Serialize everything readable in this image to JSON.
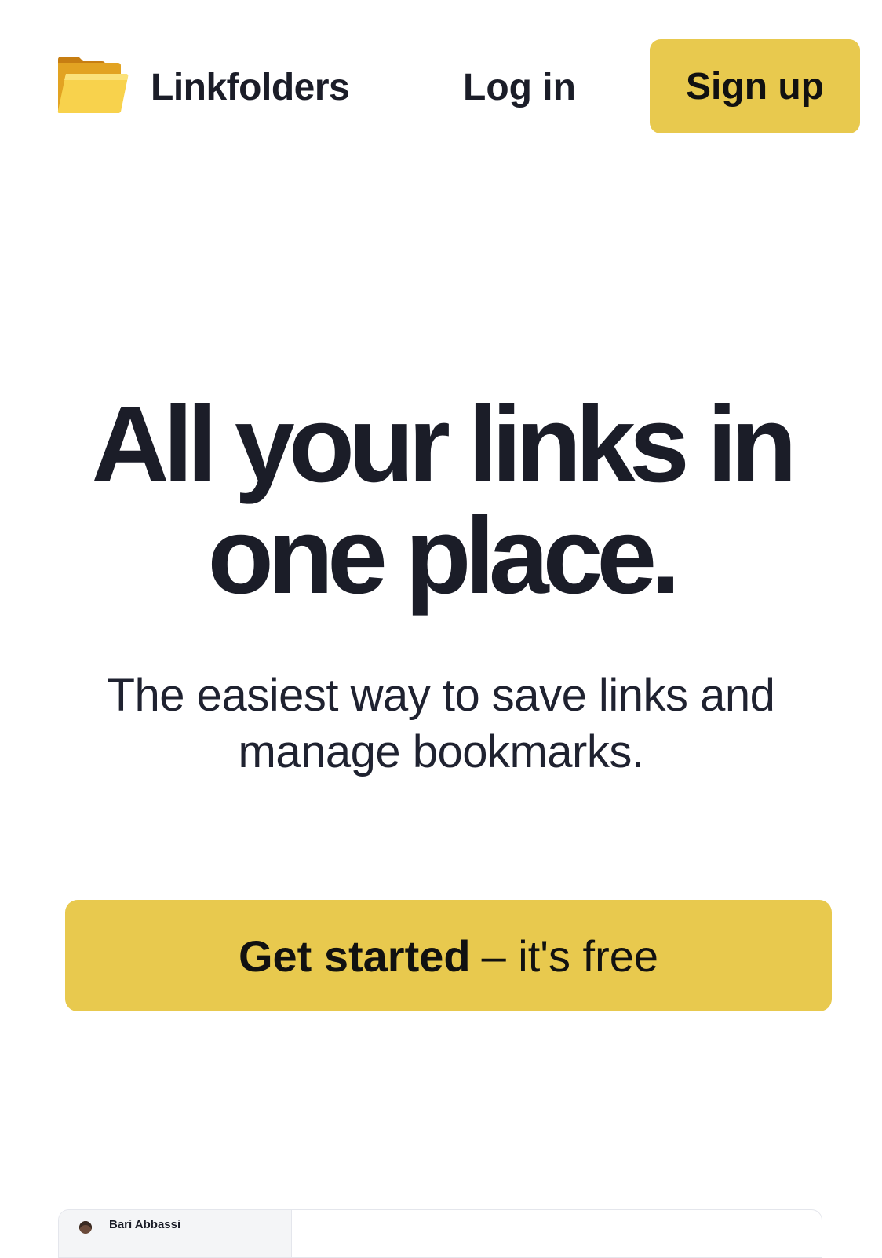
{
  "header": {
    "brand_name": "Linkfolders",
    "logo_icon": "folder-icon",
    "login_label": "Log in",
    "signup_label": "Sign up"
  },
  "hero": {
    "title": "All your links in one place.",
    "subtitle": "The easiest way to save links and manage bookmarks.",
    "cta_strong": "Get started",
    "cta_light": "– it's free"
  },
  "preview": {
    "user_name": "Bari Abbassi"
  },
  "colors": {
    "accent": "#e8c94e",
    "text": "#1b1d28",
    "background": "#ffffff"
  }
}
